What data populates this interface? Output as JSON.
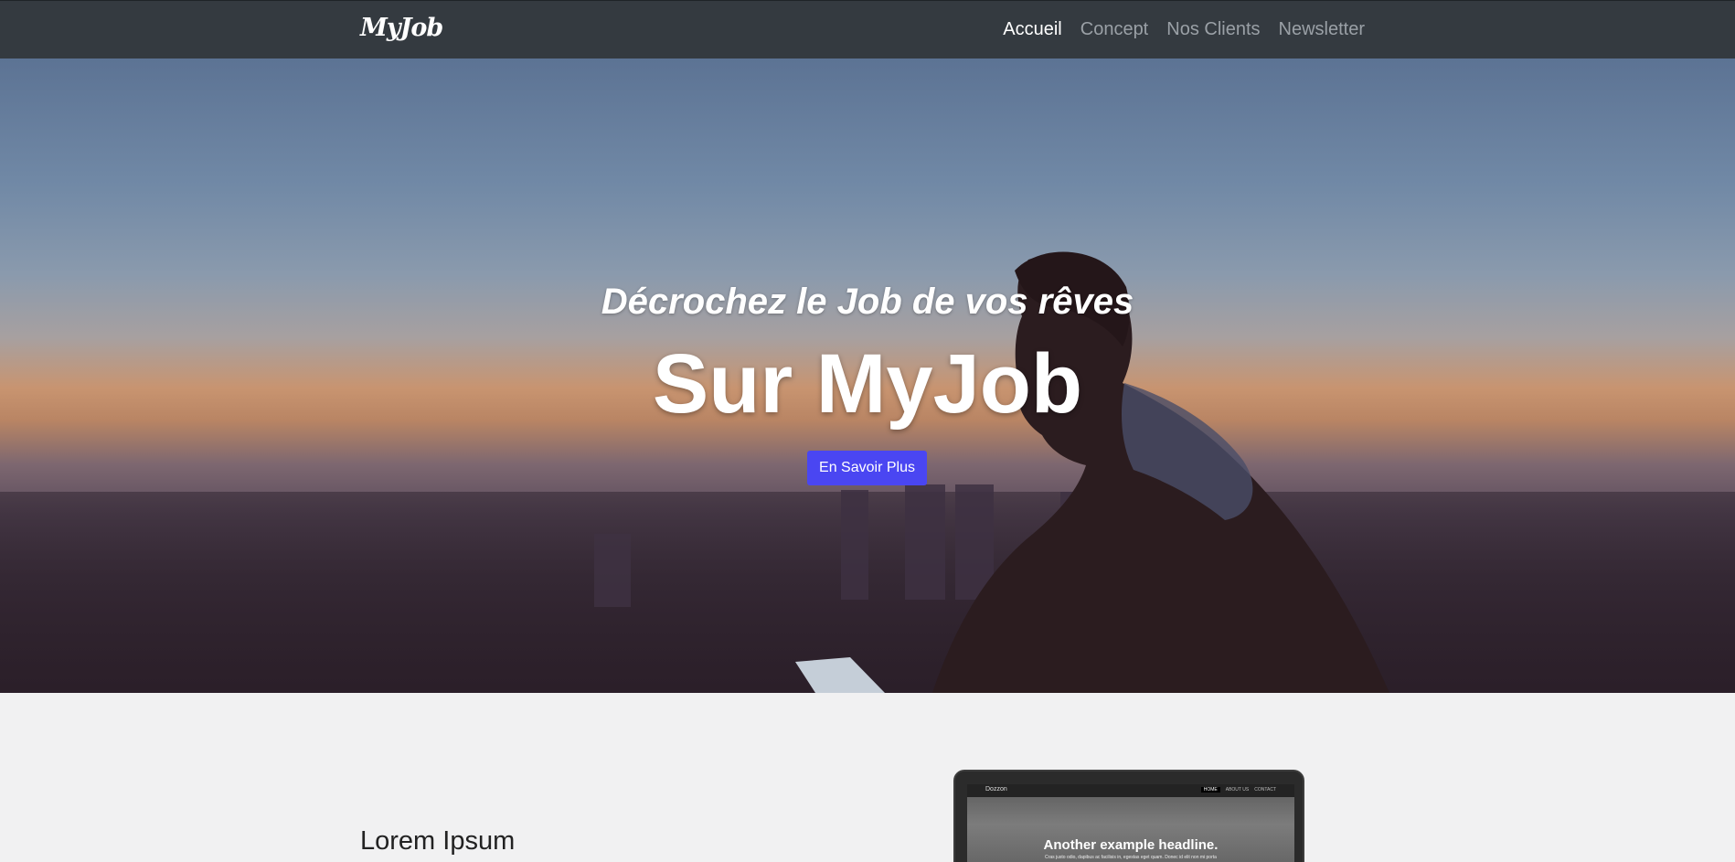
{
  "navbar": {
    "brand": "MyJob",
    "links": [
      {
        "label": "Accueil",
        "active": true
      },
      {
        "label": "Concept",
        "active": false
      },
      {
        "label": "Nos Clients",
        "active": false
      },
      {
        "label": "Newsletter",
        "active": false
      }
    ]
  },
  "hero": {
    "subtitle": "Décrochez le Job de vos rêves",
    "title": "Sur MyJob",
    "button_label": "En Savoir Plus"
  },
  "section": {
    "title": "Lorem Ipsum",
    "mockup": {
      "logo": "Dozzon",
      "nav": [
        "HOME",
        "ABOUT US",
        "CONTACT"
      ],
      "headline": "Another example headline.",
      "text": "Cras justo odio, dapibus ac facilisis in, egestas eget quam. Donec id elit non mi porta"
    }
  },
  "colors": {
    "navbar_bg": "#343a40",
    "button_bg": "#4a46f2",
    "page_bg": "#f1f1f2"
  }
}
